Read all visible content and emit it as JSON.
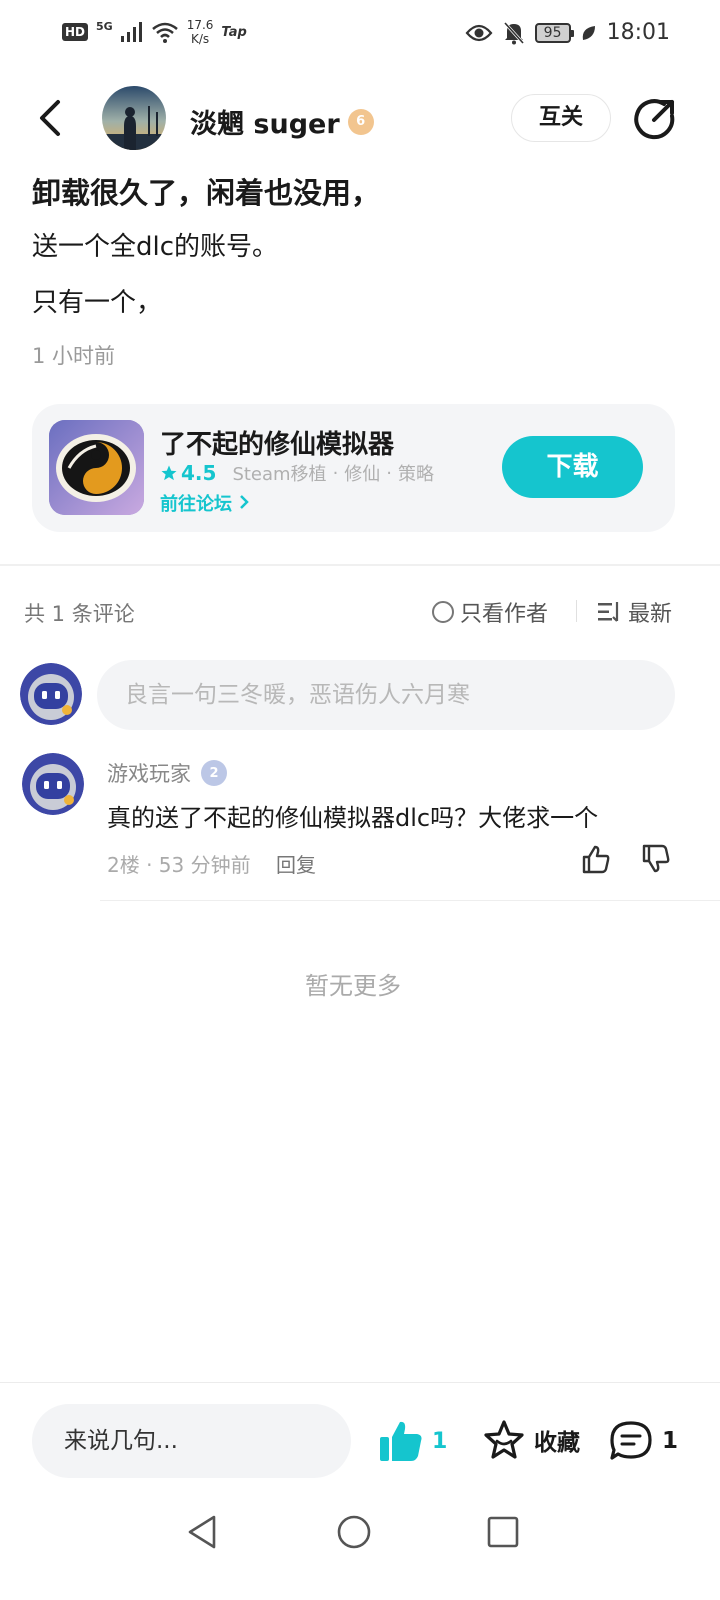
{
  "status_bar": {
    "hd": "HD",
    "network": "5G",
    "speed_value": "17.6",
    "speed_unit": "K/s",
    "app": "Tap",
    "battery": "95",
    "time": "18:01"
  },
  "header": {
    "author": "淡魍 suger",
    "author_level": "6",
    "follow_label": "互关"
  },
  "post": {
    "title": "卸载很久了，闲着也没用，",
    "line1": "送一个全dlc的账号。",
    "line2": "只有一个，",
    "time": "1 小时前"
  },
  "game": {
    "name": "了不起的修仙模拟器",
    "rating": "4.5",
    "tags": [
      "Steam移植",
      "修仙",
      "策略"
    ],
    "link": "前往论坛",
    "download_label": "下载"
  },
  "comments_bar": {
    "count_text": "共 1 条评论",
    "author_only": "只看作者",
    "sort": "最新"
  },
  "reply_input": {
    "placeholder": "良言一句三冬暖，恶语伤人六月寒"
  },
  "comments": [
    {
      "user": "游戏玩家",
      "level": "2",
      "text": "真的送了不起的修仙模拟器dlc吗？大佬求一个",
      "meta": "2楼 · 53 分钟前",
      "reply_label": "回复"
    }
  ],
  "no_more": "暂无更多",
  "bottom_bar": {
    "input_placeholder": "来说几句...",
    "like_count": "1",
    "favorite_label": "收藏",
    "comment_count": "1"
  },
  "colors": {
    "accent": "#15c5ce",
    "level_gold": "#f2c58f",
    "level_blue": "#bcc7e6"
  }
}
